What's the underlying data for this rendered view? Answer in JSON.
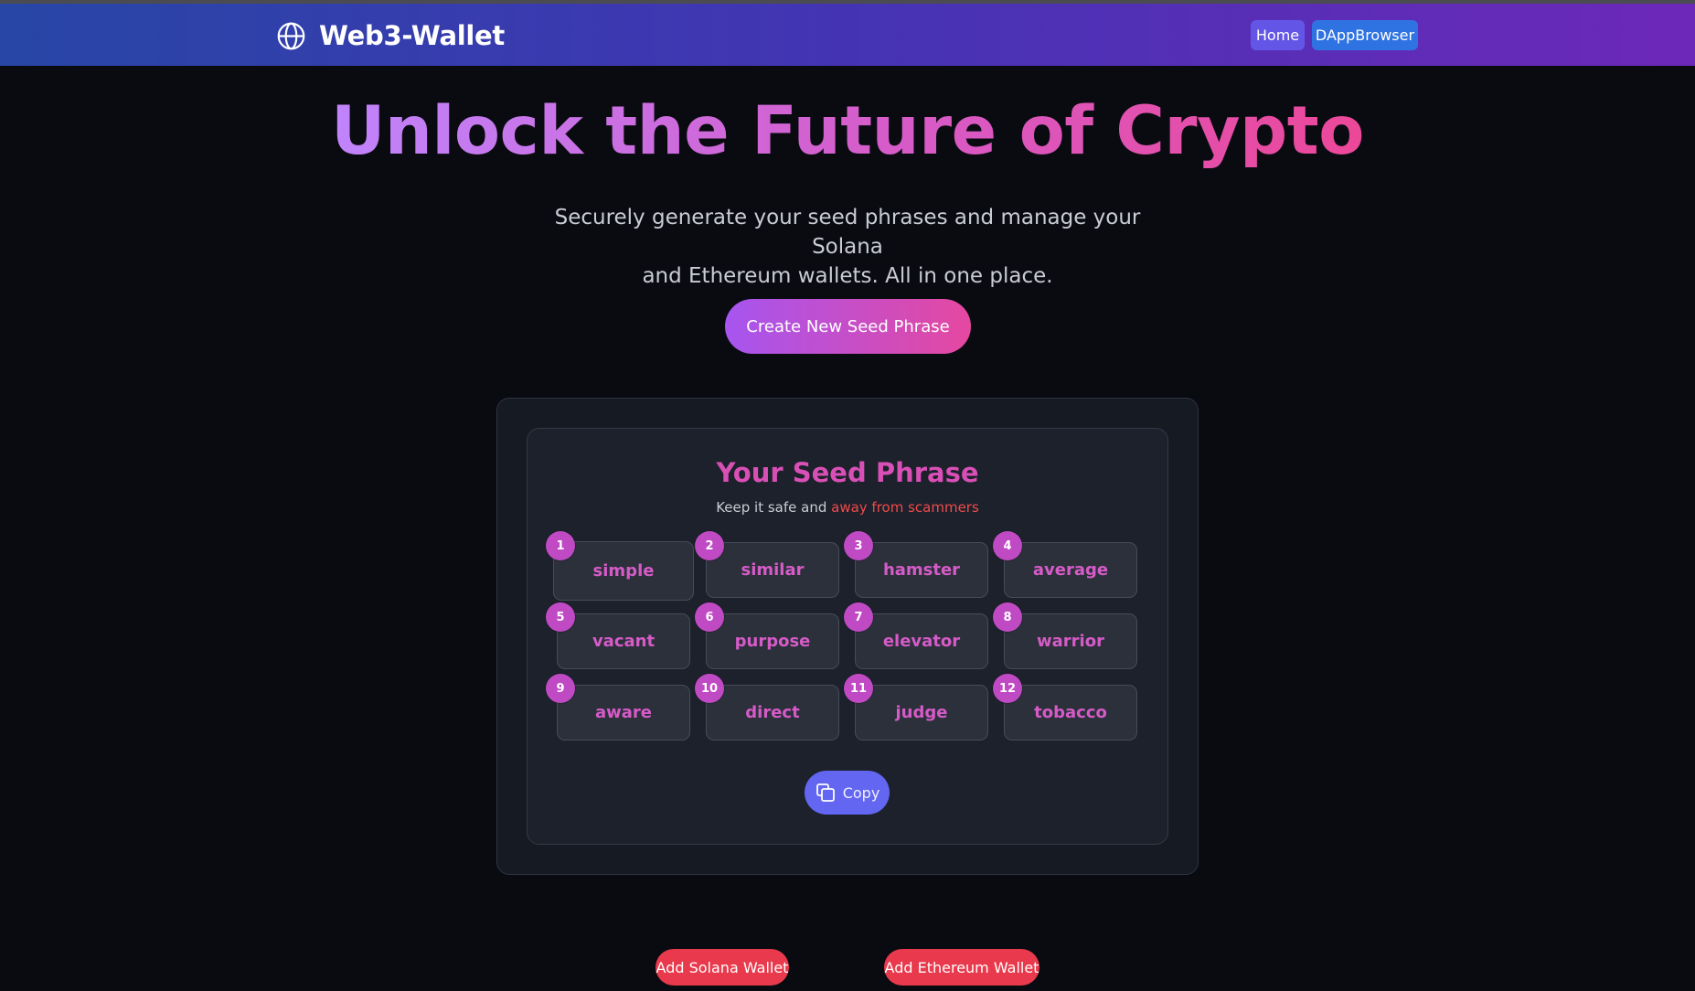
{
  "navbar": {
    "brand": "Web3-Wallet",
    "brand_icon": "globe-icon",
    "links": [
      "Home",
      "DAppBrowser"
    ],
    "gradient": [
      "#2746a6",
      "#6d28b9"
    ]
  },
  "hero": {
    "title": "Unlock the Future of Crypto",
    "subtitle_line1": "Securely generate your seed phrases and manage your Solana",
    "subtitle_line2": "and Ethereum wallets. All in one place.",
    "create_label": "Create New Seed Phrase"
  },
  "seed": {
    "title": "Your Seed Phrase",
    "subtitle": "Keep it safe and ",
    "subtitle_warning": "away from scammers",
    "words": [
      {
        "n": "1",
        "w": "simple"
      },
      {
        "n": "2",
        "w": "similar"
      },
      {
        "n": "3",
        "w": "hamster"
      },
      {
        "n": "4",
        "w": "average"
      },
      {
        "n": "5",
        "w": "vacant"
      },
      {
        "n": "6",
        "w": "purpose"
      },
      {
        "n": "7",
        "w": "elevator"
      },
      {
        "n": "8",
        "w": "warrior"
      },
      {
        "n": "9",
        "w": "aware"
      },
      {
        "n": "10",
        "w": "direct"
      },
      {
        "n": "11",
        "w": "judge"
      },
      {
        "n": "12",
        "w": "tobacco"
      }
    ],
    "copy_label": "Copy",
    "copy_icon": "copy-icon"
  },
  "wallets": {
    "solana_label": "Add Solana Wallet",
    "ethereum_label": "Add Ethereum Wallet"
  },
  "colors": {
    "accent_pink": "#d65bc8",
    "badge": "#c04ac4",
    "copy_button": "#6366f1",
    "wallet_button": "#e83a4c",
    "danger_text": "#f14a4a",
    "background": "#0a0b11"
  }
}
